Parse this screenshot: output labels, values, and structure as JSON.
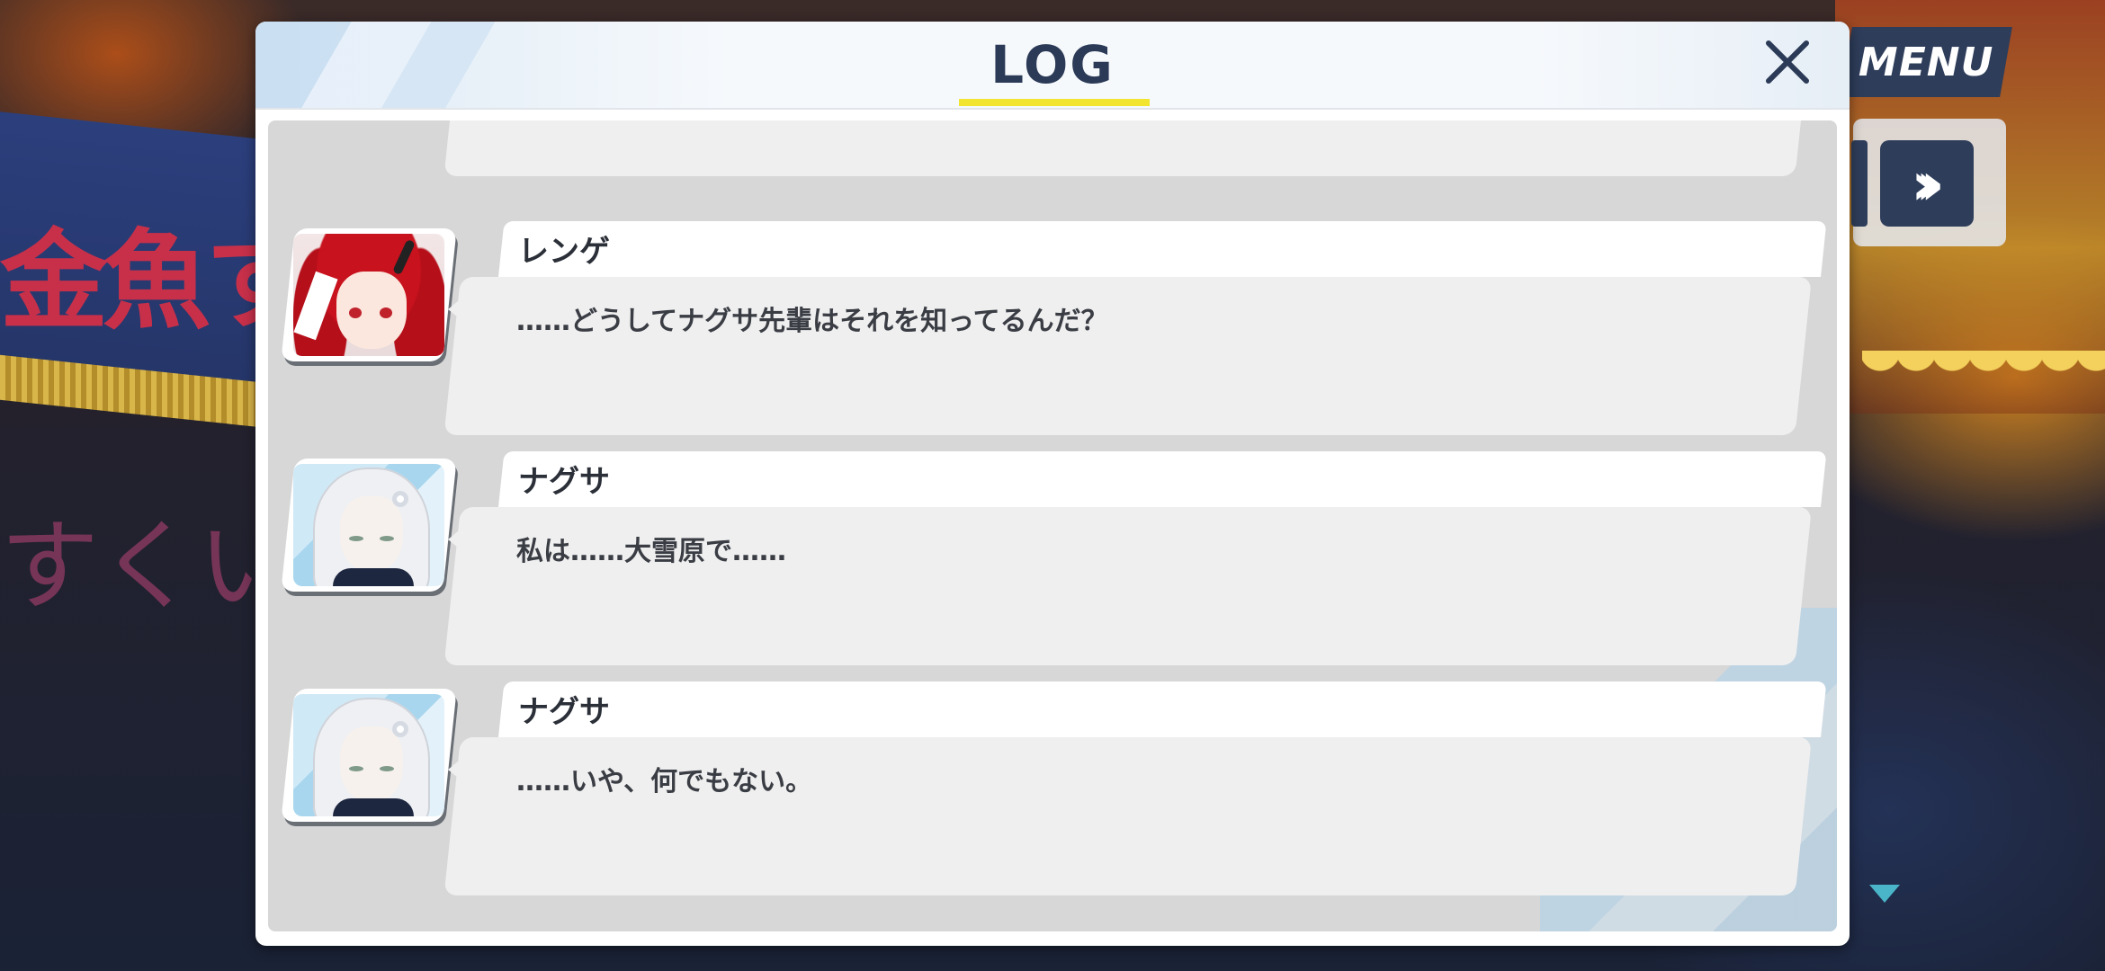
{
  "background": {
    "sign_text": "金魚すく",
    "sign_text_lower": "すくい"
  },
  "controls": {
    "menu_label": "MENU",
    "skip_label": "»",
    "skip_icon": "fast-forward-icon",
    "auto_icon": "auto-play-icon",
    "scroll_indicator_icon": "triangle-down-icon"
  },
  "log": {
    "title": "LOG",
    "close_icon": "close-icon",
    "accent_color": "#f2e52f",
    "title_color": "#2b3a56",
    "entries": [
      {
        "speaker": "レンゲ",
        "text": "……どうしてナグサ先輩はそれを知ってるんだ？",
        "portrait": "renge-portrait"
      },
      {
        "speaker": "ナグサ",
        "text": "私は……大雪原で……",
        "portrait": "nagusa-portrait"
      },
      {
        "speaker": "ナグサ",
        "text": "……いや、何でもない。",
        "portrait": "nagusa-portrait"
      }
    ]
  }
}
